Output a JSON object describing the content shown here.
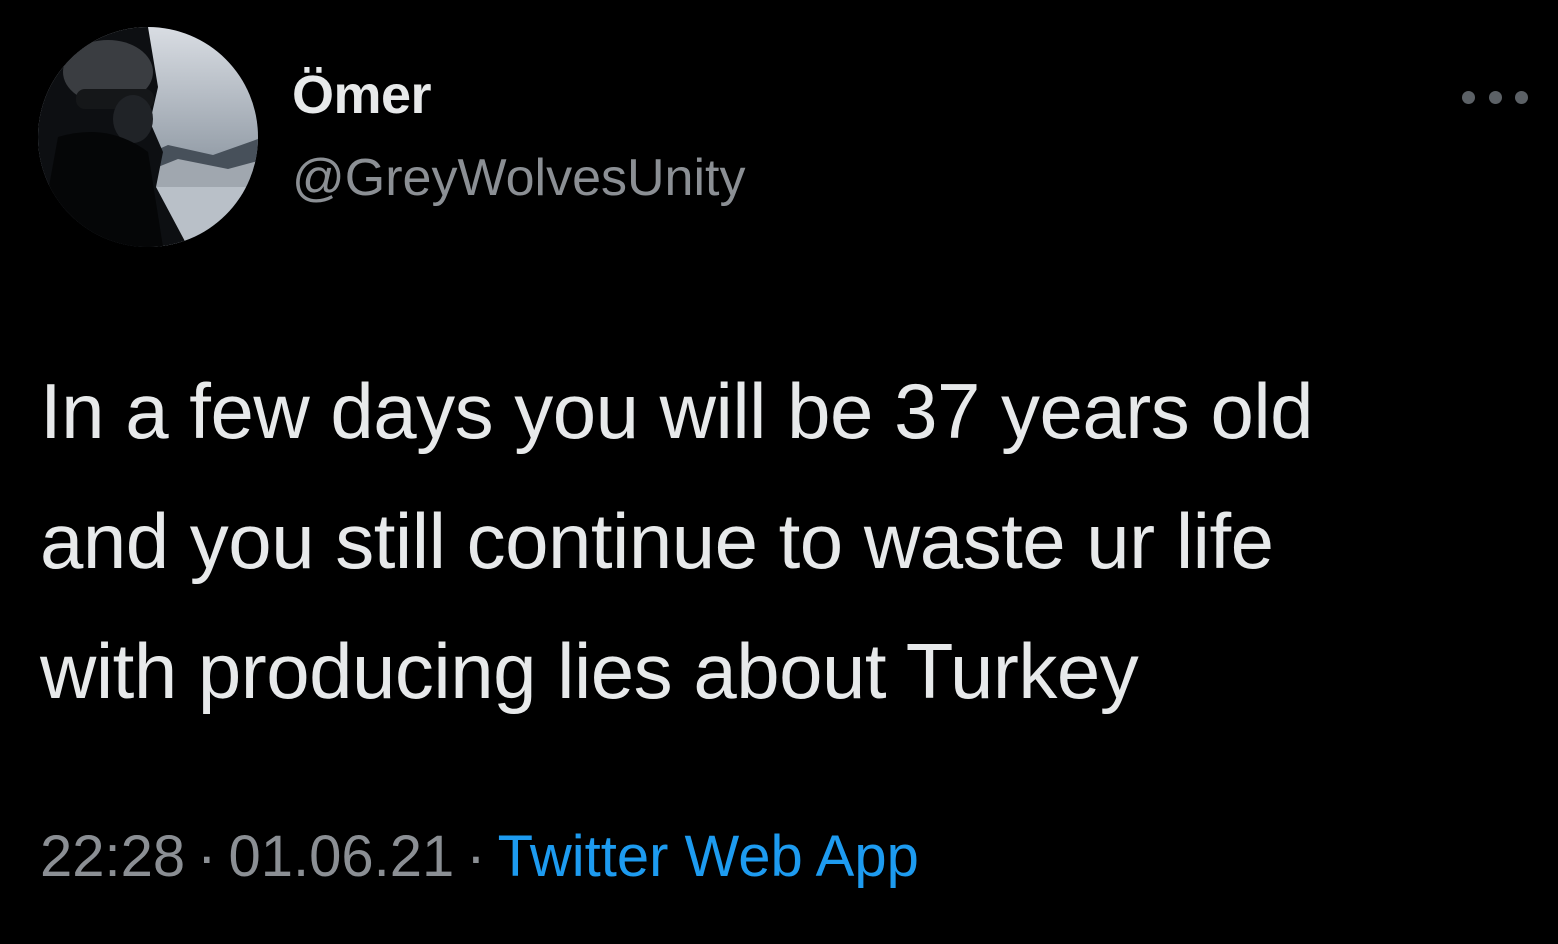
{
  "user": {
    "display_name": "Ömer",
    "handle": "@GreyWolvesUnity",
    "avatar_icon": "profile-photo"
  },
  "tweet": {
    "text": "In a few days you will be 37 years old\nand you still continue to waste ur life\nwith producing lies about Turkey",
    "time": "22:28",
    "date": "01.06.21",
    "separator": "·",
    "source": "Twitter Web App"
  },
  "menu": {
    "icon": "more-horizontal-icon"
  },
  "colors": {
    "background": "#000000",
    "text": "#e7e9ea",
    "secondary_text": "#8b8f94",
    "link": "#1d9bf0"
  }
}
